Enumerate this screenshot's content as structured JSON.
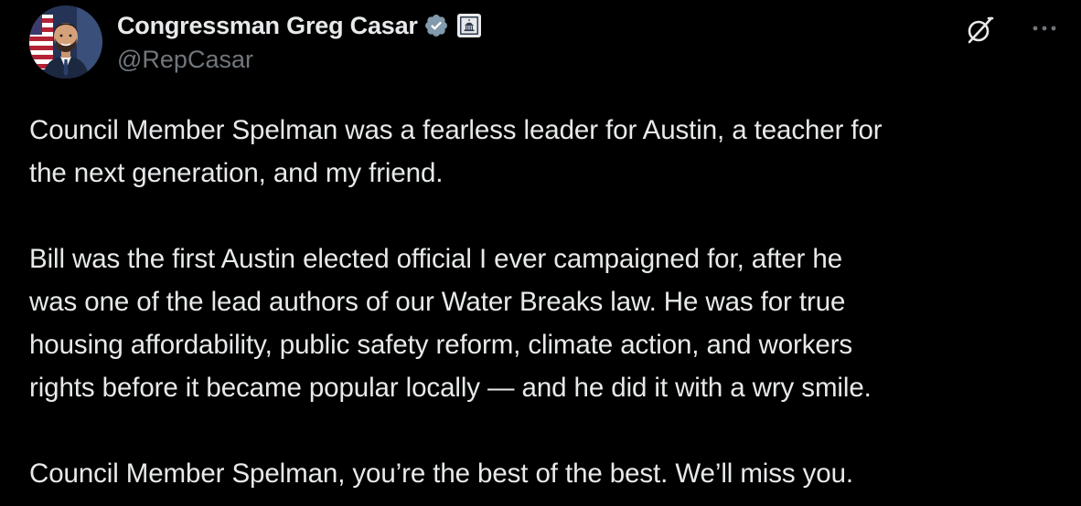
{
  "author": {
    "display_name": "Congressman Greg Casar",
    "handle": "@RepCasar",
    "verified_badge_icon": "verified-check-icon",
    "affiliation_badge_icon": "government-capitol-icon",
    "colors": {
      "verified_badge": "#829aab",
      "handle": "#71767b",
      "text": "#e7e9ea"
    }
  },
  "actions": {
    "grok_icon": "grok-slash-icon",
    "more_icon": "more-horizontal-icon"
  },
  "tweet": {
    "paragraphs": [
      "Council Member Spelman was a fearless leader for Austin, a teacher for\nthe next generation, and my friend.",
      "Bill was the first Austin elected official I ever campaigned for, after he\nwas one of the lead authors of our Water Breaks law. He was for true\nhousing affordability, public safety reform, climate action, and workers\nrights before it became popular locally —  and he did it with a wry smile.",
      "Council Member Spelman, you’re the best of the best. We’ll miss you."
    ]
  }
}
